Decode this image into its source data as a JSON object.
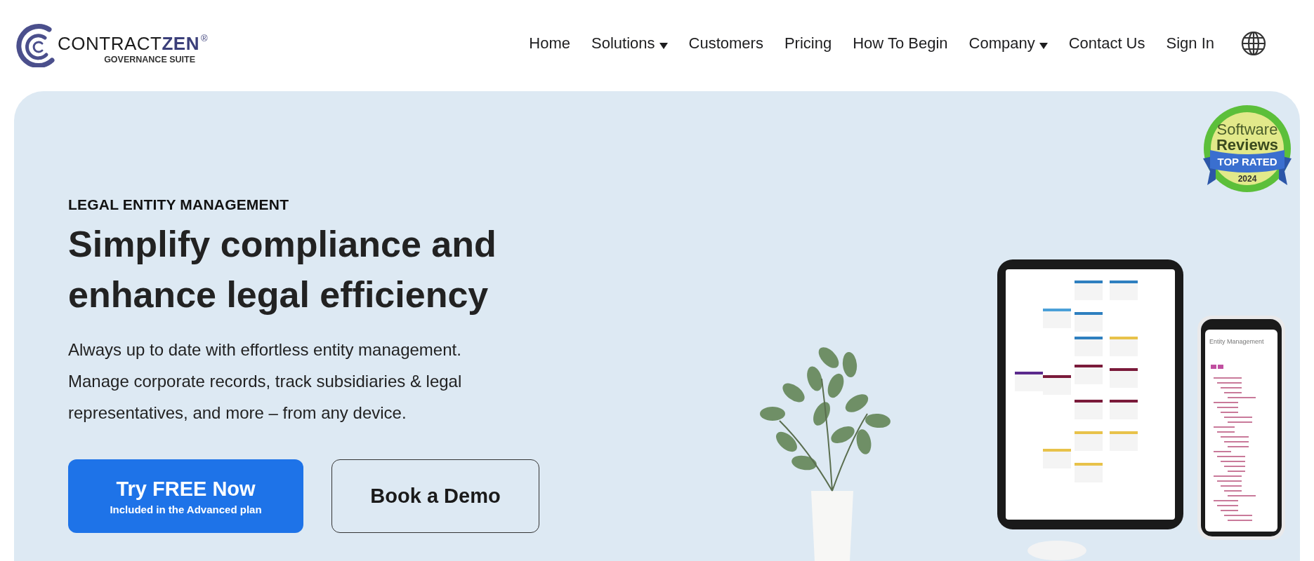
{
  "header": {
    "logo": {
      "brand_light": "CONTRACT",
      "brand_bold": "ZEN",
      "registered": "®",
      "tagline": "GOVERNANCE SUITE"
    },
    "nav": [
      {
        "label": "Home",
        "dropdown": false
      },
      {
        "label": "Solutions",
        "dropdown": true
      },
      {
        "label": "Customers",
        "dropdown": false
      },
      {
        "label": "Pricing",
        "dropdown": false
      },
      {
        "label": "How To Begin",
        "dropdown": false
      },
      {
        "label": "Company",
        "dropdown": true
      },
      {
        "label": "Contact Us",
        "dropdown": false
      },
      {
        "label": "Sign In",
        "dropdown": false
      }
    ]
  },
  "hero": {
    "eyebrow": "LEGAL ENTITY MANAGEMENT",
    "headline": [
      "Simplify compliance and",
      "enhance legal efficiency"
    ],
    "description": [
      "Always up to date with effortless entity management.",
      "Manage corporate records, track subsidiaries & legal",
      "representatives, and more – from any device."
    ],
    "primary_button": {
      "label": "Try FREE Now",
      "sublabel": "Included in the Advanced plan"
    },
    "secondary_button": {
      "label": "Book a Demo"
    },
    "badge": {
      "line_1": "Software",
      "line_2": "Reviews",
      "ribbon": "TOP RATED",
      "year": "2024"
    },
    "phone_title": "Entity Management"
  }
}
